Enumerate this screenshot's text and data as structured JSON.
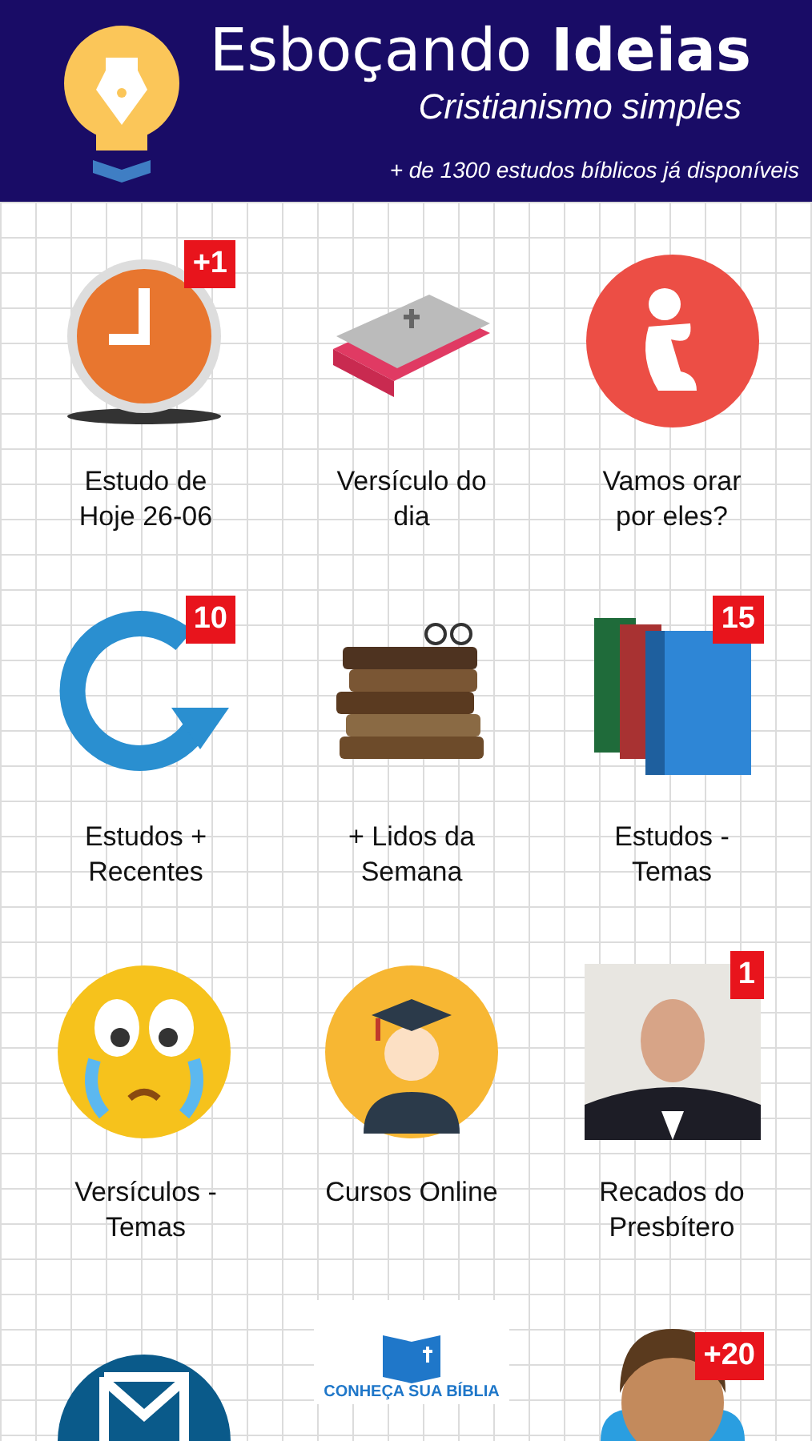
{
  "header": {
    "title_regular": "Esboçando",
    "title_bold": "Ideias",
    "subtitle": "Cristianismo simples",
    "tagline": "+ de 1300 estudos bíblicos já disponíveis"
  },
  "tiles": [
    {
      "kind": "clock",
      "label": [
        "Estudo de",
        "Hoje 26-06"
      ],
      "badge": "+1"
    },
    {
      "kind": "bible",
      "label": [
        "Versículo do",
        "dia"
      ]
    },
    {
      "kind": "pray",
      "label": [
        "Vamos orar",
        "por eles?"
      ]
    },
    {
      "kind": "refresh",
      "label": [
        "Estudos +",
        "Recentes"
      ],
      "badge": "10"
    },
    {
      "kind": "stack",
      "label": [
        "+ Lidos da",
        "Semana"
      ]
    },
    {
      "kind": "books",
      "label": [
        "Estudos -",
        "Temas"
      ],
      "badge": "15"
    },
    {
      "kind": "crying",
      "label": [
        "Versículos -",
        "Temas"
      ]
    },
    {
      "kind": "graduate",
      "label": [
        "Cursos Online"
      ]
    },
    {
      "kind": "picture",
      "label": [
        "Recados do",
        "Presbítero"
      ],
      "badge": "1"
    },
    {
      "kind": "mail"
    },
    {
      "kind": "logo",
      "logo_text": "CONHEÇA SUA BÍBLIA"
    },
    {
      "kind": "figure",
      "badge": "+20"
    }
  ]
}
